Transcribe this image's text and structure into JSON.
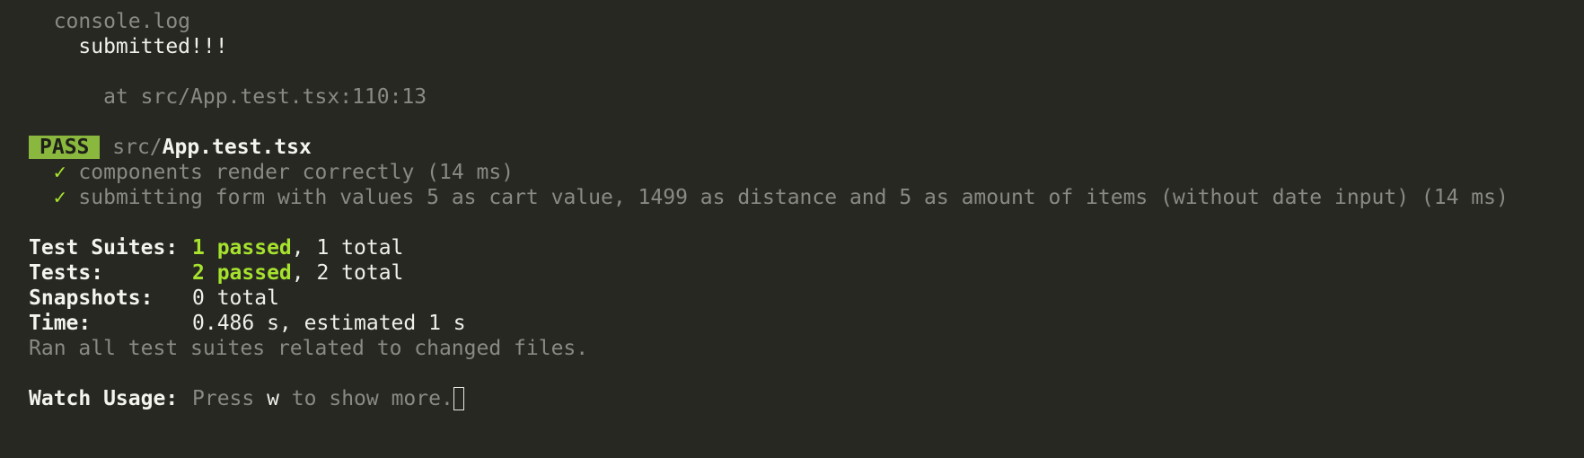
{
  "console": {
    "header": "console.log",
    "message": "submitted!!!",
    "location": "at src/App.test.tsx:110:13"
  },
  "result": {
    "badge": "PASS",
    "path_prefix": "src/",
    "file": "App.test.tsx"
  },
  "tests": [
    {
      "check": "✓",
      "name": "components render correctly (14 ms)"
    },
    {
      "check": "✓",
      "name": "submitting form with values 5 as cart value, 1499 as distance and 5 as amount of items (without date input) (14 ms)"
    }
  ],
  "summary": {
    "suites_label": "Test Suites:",
    "suites_passed": "1 passed",
    "suites_total": ", 1 total",
    "tests_label": "Tests:",
    "tests_passed": "2 passed",
    "tests_total": ", 2 total",
    "snapshots_label": "Snapshots:",
    "snapshots_value": "0 total",
    "time_label": "Time:",
    "time_value": "0.486 s, estimated 1 s",
    "ran_all": "Ran all test suites related to changed files."
  },
  "watch": {
    "label": "Watch Usage:",
    "prefix": "Press ",
    "key": "w",
    "suffix": " to show more."
  },
  "colors": {
    "background": "#272822",
    "pass_badge": "#8ab83e",
    "passed_text": "#a6e22e",
    "dim_text": "#8a8a84"
  }
}
